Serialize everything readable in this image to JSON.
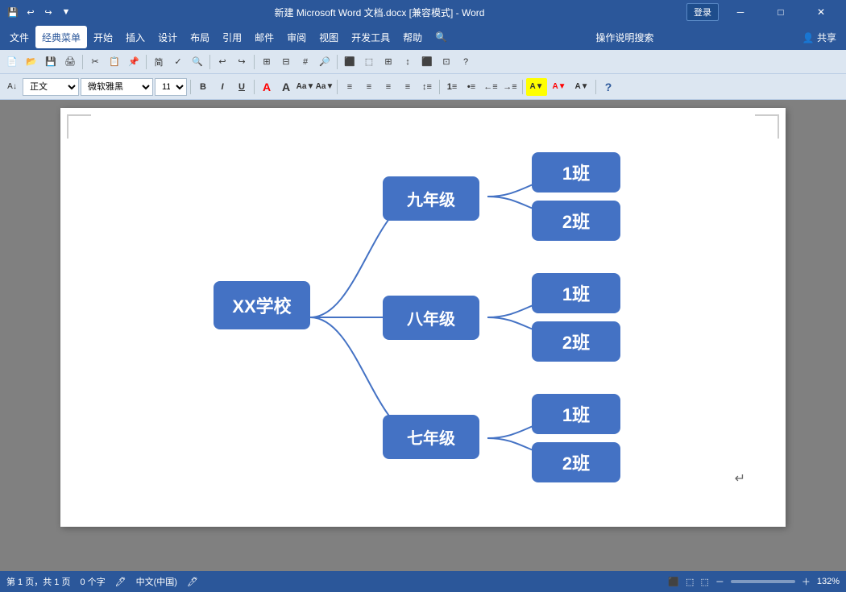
{
  "titlebar": {
    "title": "新建 Microsoft Word 文档.docx [兼容模式] - Word",
    "login_label": "登录",
    "win_min": "─",
    "win_restore": "□",
    "win_close": "✕"
  },
  "menubar": {
    "items": [
      "文件",
      "经典菜单",
      "开始",
      "插入",
      "设计",
      "布局",
      "引用",
      "邮件",
      "审阅",
      "视图",
      "开发工具",
      "帮助"
    ],
    "active_index": 1,
    "right_items": [
      "操作说明搜索",
      "共享"
    ]
  },
  "statusbar": {
    "page": "第 1 页，共 1 页",
    "words": "0 个字",
    "lang": "中文(中国)",
    "zoom": "132%"
  },
  "diagram": {
    "root": "XX学校",
    "branches": [
      {
        "label": "九年级",
        "classes": [
          "1班",
          "2班"
        ]
      },
      {
        "label": "八年级",
        "classes": [
          "1班",
          "2班"
        ]
      },
      {
        "label": "七年级",
        "classes": [
          "1班",
          "2班"
        ]
      }
    ]
  },
  "formatting": {
    "style": "正文",
    "font": "微软雅黑",
    "size": "11"
  }
}
